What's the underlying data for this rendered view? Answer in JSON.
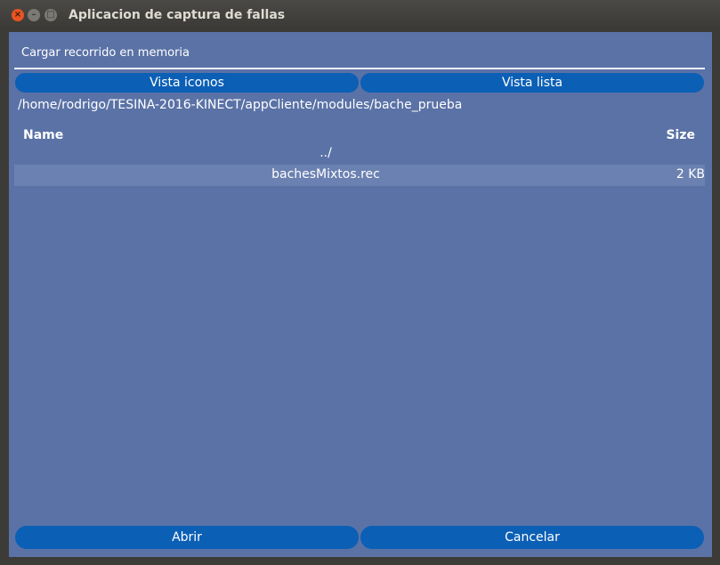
{
  "window": {
    "title": "Aplicacion de captura de fallas"
  },
  "dialog": {
    "heading": "Cargar recorrido en memoria",
    "view_icons_label": "Vista iconos",
    "view_list_label": "Vista lista",
    "path": "/home/rodrigo/TESINA-2016-KINECT/appCliente/modules/bache_prueba",
    "columns": {
      "name": "Name",
      "size": "Size"
    },
    "entries": [
      {
        "name": "../",
        "size": ""
      },
      {
        "name": "bachesMixtos.rec",
        "size": "2 KB"
      }
    ],
    "open_label": "Abrir",
    "cancel_label": "Cancelar"
  },
  "colors": {
    "accent": "#0b5fb5",
    "background": "#5a72a6",
    "selected_row": "#6b81b1",
    "close_button": "#e95420"
  }
}
